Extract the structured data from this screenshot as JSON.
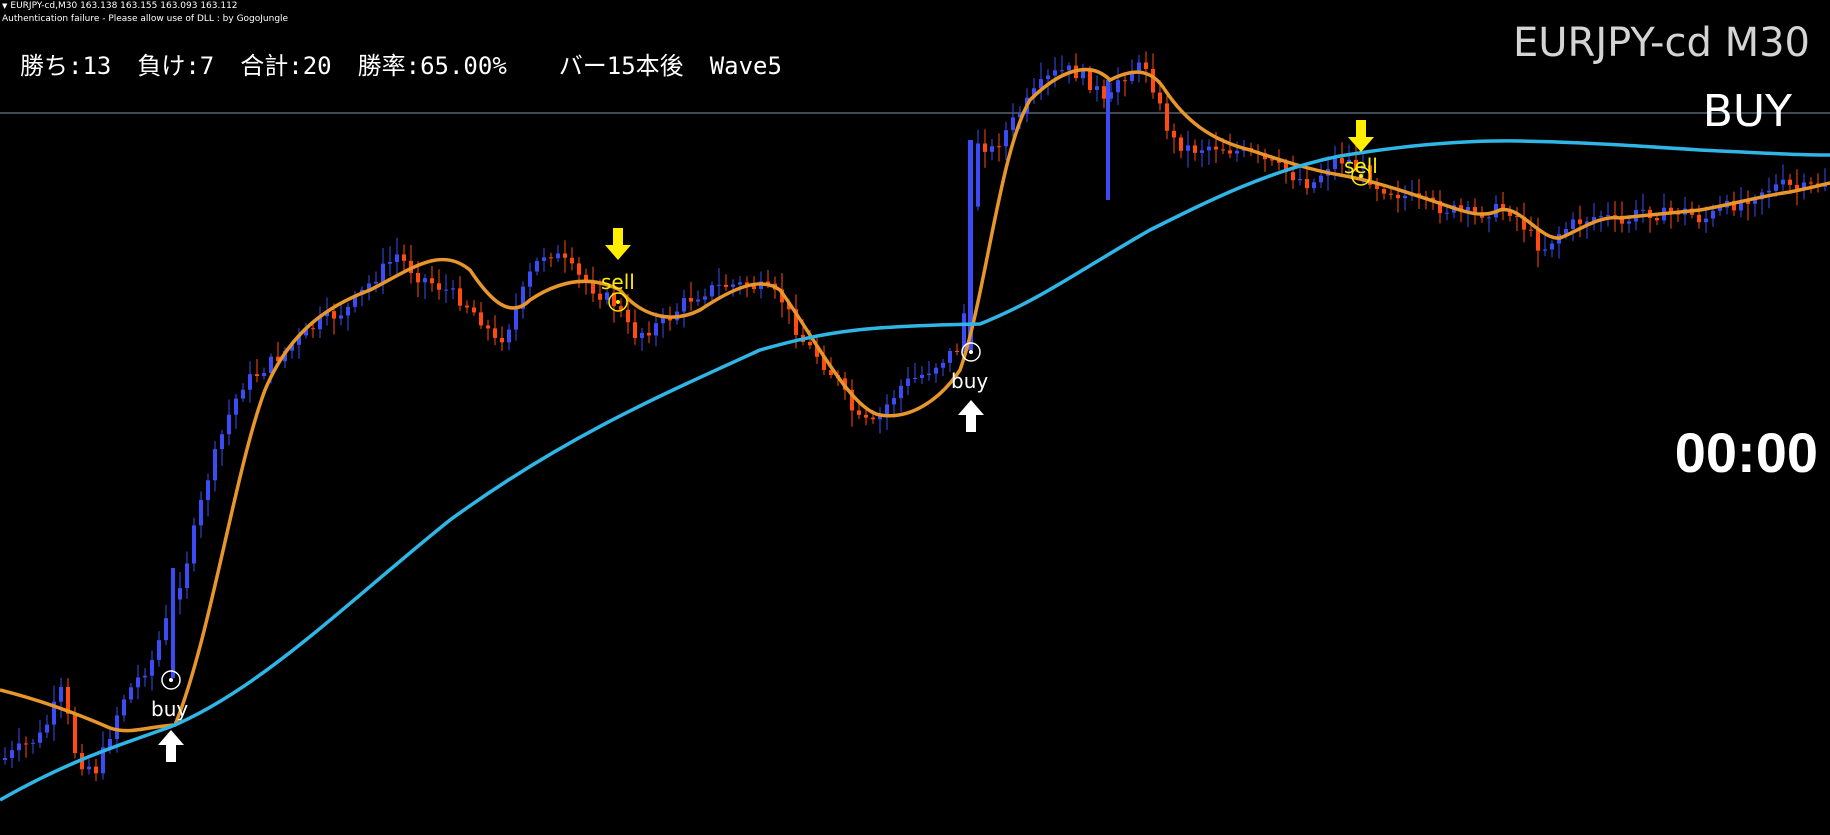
{
  "header": {
    "line1": "EURJPY-cd,M30  163.138 163.155 163.093 163.112",
    "line2": "Authentication failure - Please allow use of DLL : by GogoJungle"
  },
  "stats": {
    "wins": "勝ち:13",
    "losses": "負け:7",
    "total": "合計:20",
    "winrate": "勝率:65.00%",
    "bars_after": "バー15本後",
    "wave": "Wave5"
  },
  "symbol_label": "EURJPY-cd M30",
  "signal_label": "BUY",
  "timer": "00:00",
  "signals": [
    {
      "type": "buy",
      "label": "buy"
    },
    {
      "type": "sell",
      "label": "sell"
    },
    {
      "type": "buy",
      "label": "buy"
    },
    {
      "type": "sell",
      "label": "sell"
    }
  ],
  "colors": {
    "background": "#000000",
    "bull_candle": "#3b4cf5",
    "bear_candle": "#ff4a12",
    "fast_line": "#e6962b",
    "slow_line": "#2fb6e6",
    "sell_arrow": "#ffee00",
    "buy_arrow": "#ffffff",
    "level_line": "#7e95ad"
  }
}
